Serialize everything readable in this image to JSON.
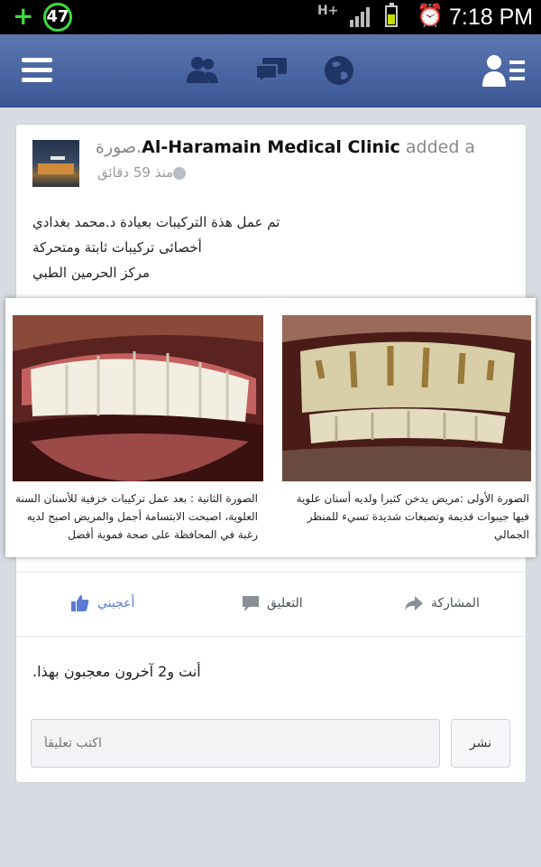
{
  "status_bar": {
    "notification_count": "47",
    "network_label": "H+",
    "time": "7:18 PM",
    "battery_level": 0.5
  },
  "nav": {
    "icons": [
      "menu-icon",
      "friend-requests-icon",
      "messages-icon",
      "notifications-globe-icon",
      "friends-list-icon"
    ]
  },
  "post": {
    "page_name": "Al-Haramain Medical Clinic",
    "action_text": "added a",
    "action_suffix": "صورة.",
    "timestamp": "منذ 59 دقائق",
    "text_lines": [
      "تم عمل هذة التركيبات بعيادة د.محمد بغدادي",
      "أخصائى تركيبات ثابتة ومتحركة",
      "مركز الحرمين الطبي"
    ],
    "photo_captions": {
      "left": "الصورة الثانية : بعد عمل تركيبات خزفية للأسنان السنة العلوية، اصبحت الابتسامة أجمل والمريض اصبح لديه رغبة في المحافظة على صحة فموية أفضل",
      "right": "الصورة الأولى :مريض يدخن كثيرا ولديه أسنان علوية فيها جيبوات قديمة وتصبغات شديدة تسيء للمنظر الجمالي"
    }
  },
  "actions": {
    "like": "أعجبني",
    "comment": "التعليق",
    "share": "المشاركة"
  },
  "likes_summary": "أنت و2 آخرون معجبون بهذا.",
  "comment_input": {
    "placeholder": "اكتب تعليقاً"
  },
  "post_button": "نشر",
  "colors": {
    "nav_blue": "#3b5998",
    "like_blue": "#5b7bd5"
  }
}
